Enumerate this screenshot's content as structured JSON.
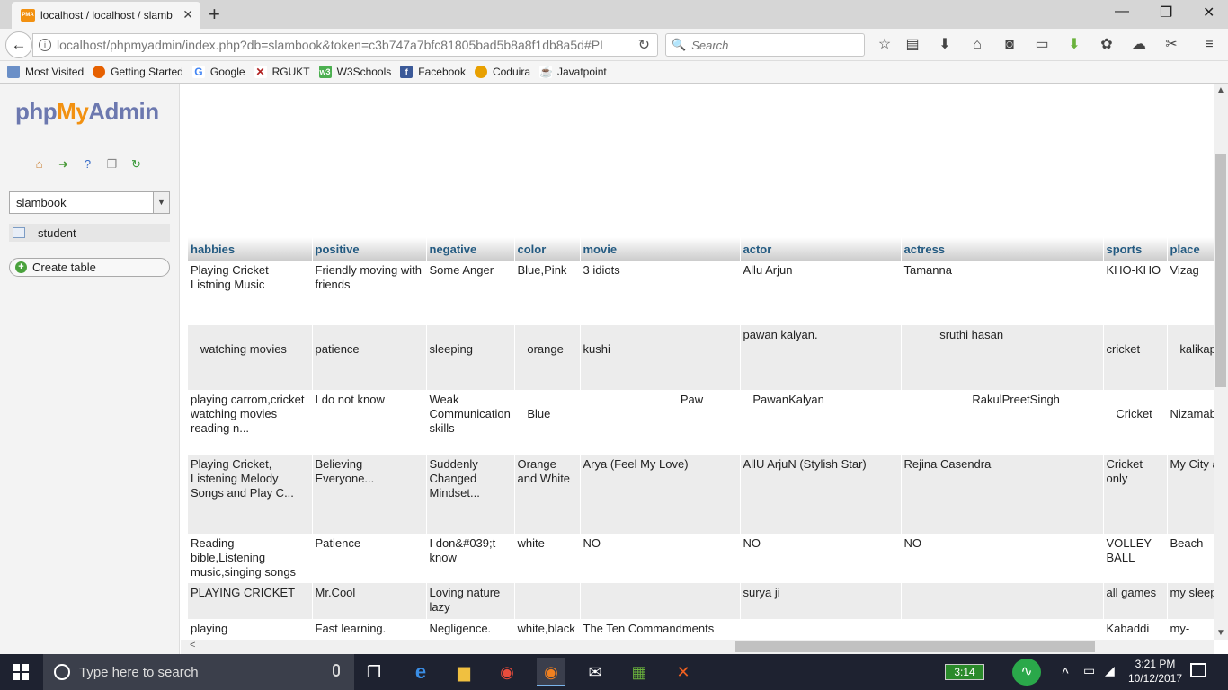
{
  "browser": {
    "tab_title": "localhost / localhost / slamb",
    "url": "localhost/phpmyadmin/index.php?db=slambook&token=c3b747a7bfc81805bad5b8a8f1db8a5d#PI",
    "search_placeholder": "Search"
  },
  "bookmarks": [
    {
      "label": "Most Visited",
      "icon": "most-visited-icon",
      "color": "#6a8fc7"
    },
    {
      "label": "Getting Started",
      "icon": "firefox-icon",
      "color": "#e66000"
    },
    {
      "label": "Google",
      "icon": "google-icon",
      "color": "#4285f4"
    },
    {
      "label": "RGUKT",
      "icon": "rgukt-icon",
      "color": "#b22222"
    },
    {
      "label": "W3Schools",
      "icon": "w3schools-icon",
      "color": "#4caf50"
    },
    {
      "label": "Facebook",
      "icon": "facebook-icon",
      "color": "#3b5998"
    },
    {
      "label": "Coduira",
      "icon": "coduira-icon",
      "color": "#e8a000"
    },
    {
      "label": "Javatpoint",
      "icon": "javatpoint-icon",
      "color": "#c9302c"
    }
  ],
  "sidebar": {
    "logo_php": "php",
    "logo_my": "My",
    "logo_admin": "Admin",
    "database": "slambook",
    "table": "student",
    "create_table": "Create table"
  },
  "grid": {
    "headers": [
      "habbies",
      "positive",
      "negative",
      "color",
      "movie",
      "actor",
      "actress",
      "sports",
      "place"
    ],
    "rows": [
      [
        "Playing Cricket\nListning Music",
        "Friendly moving with friends",
        "Some Anger",
        "Blue,Pink",
        "3 idiots",
        "Allu Arjun",
        "Tamanna",
        "KHO-KHO",
        "Vizag"
      ],
      [
        "   watching movies",
        "patience",
        "sleeping",
        "   orange",
        "kushi",
        "pawan kalyan.",
        "           sruthi hasan",
        "cricket",
        "   kalikap"
      ],
      [
        "playing carrom,cricket watching movies reading n...",
        "I do not know",
        "Weak Communication skills",
        "   Blue",
        "                              Paw",
        "   PawanKalyan",
        "                     RakulPreetSingh",
        "   Cricket",
        "Nizamab"
      ],
      [
        "Playing Cricket, Listening Melody Songs and Play C...",
        "Believing Everyone...",
        "Suddenly Changed Mindset...",
        "Orange and White",
        "Arya (Feel My Love)",
        "AllU ArjuN (Stylish Star)",
        "Rejina Casendra",
        "Cricket only",
        "My City an"
      ],
      [
        "Reading bible,Listening music,singing songs",
        "Patience",
        "I don&#039;t know",
        "white",
        "NO",
        "NO",
        "NO",
        "VOLLEY BALL",
        "Beach"
      ],
      [
        "PLAYING CRICKET",
        "Mr.Cool",
        "Loving nature lazy",
        "",
        "",
        "surya ji",
        "",
        "all games",
        "my sleepin"
      ],
      [
        "playing",
        "Fast learning.",
        "Negligence.",
        "white,black",
        "The Ten Commandments",
        "",
        "",
        "Kabaddi",
        "my-"
      ]
    ]
  },
  "taskbar": {
    "search_placeholder": "Type here to search",
    "battery": "3:14",
    "time": "3:21 PM",
    "date": "10/12/2017"
  }
}
